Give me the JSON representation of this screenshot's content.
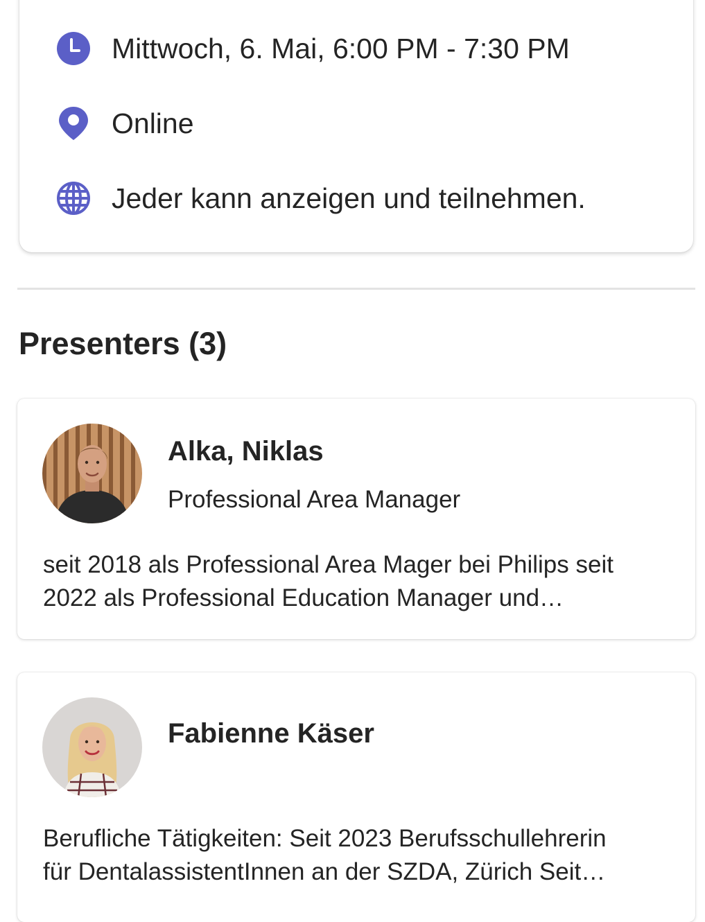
{
  "event_info": {
    "time": {
      "icon": "clock-icon",
      "text": "Mittwoch, 6. Mai, 6:00 PM - 7:30 PM"
    },
    "location": {
      "icon": "location-pin-icon",
      "text": "Online"
    },
    "visibility": {
      "icon": "globe-icon",
      "text": "Jeder kann anzeigen und teilnehmen."
    },
    "icon_color": "#5b5fc7"
  },
  "presenters_section": {
    "title": "Presenters (3)",
    "presenters": [
      {
        "name": "Alka, Niklas",
        "role": "Professional Area Manager",
        "bio_lines": [
          "seit 2018 als Professional Area Mager bei Philips seit",
          "2022 als Professional Education Manager und…"
        ]
      },
      {
        "name": "Fabienne Käser",
        "role": "",
        "bio_lines": [
          "Berufliche Tätigkeiten: Seit 2023 Berufsschullehrerin",
          "für DentalassistentInnen an der SZDA, Zürich Seit…"
        ]
      }
    ]
  }
}
